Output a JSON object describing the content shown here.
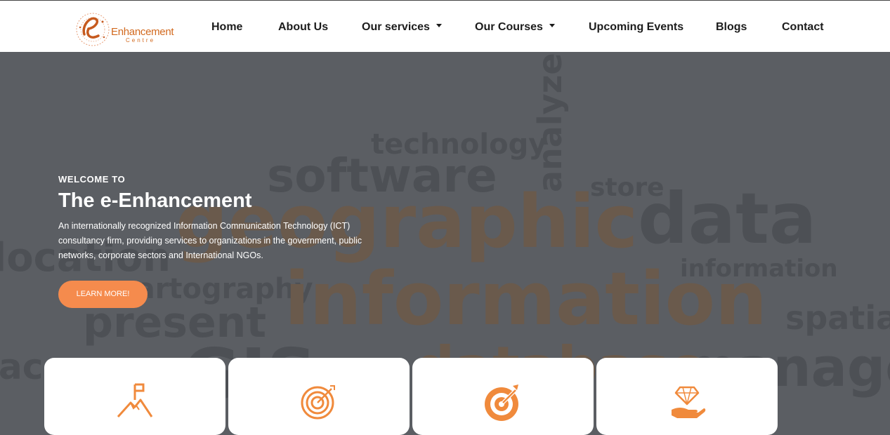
{
  "header": {
    "logo": {
      "text": "Enhancement",
      "subtext": "Centre",
      "icon": "e-letter-logo-icon"
    },
    "nav": [
      {
        "label": "Home"
      },
      {
        "label": "About Us"
      },
      {
        "label": "Our services",
        "dropdown": true
      },
      {
        "label": "Our Courses",
        "dropdown": true
      },
      {
        "label": "Upcoming Events"
      },
      {
        "label": "Blogs"
      },
      {
        "label": "Contact"
      }
    ]
  },
  "hero": {
    "eyebrow": "WELCOME TO",
    "title": "The e-Enhancement",
    "description": "An internationally recognized Information Communication Technology (ICT) consultancy firm, providing services to organizations in the government, public networks, corporate sectors and International NGOs.",
    "button_label": "LEARN MORE!",
    "background_words": [
      {
        "text": "analyze"
      },
      {
        "text": "technology"
      },
      {
        "text": "software"
      },
      {
        "text": "store"
      },
      {
        "text": "geographic"
      },
      {
        "text": "data"
      },
      {
        "text": "location"
      },
      {
        "text": "information"
      },
      {
        "text": "cartography"
      },
      {
        "text": "information"
      },
      {
        "text": "present"
      },
      {
        "text": "spatial"
      },
      {
        "text": "manage"
      },
      {
        "text": "ac"
      },
      {
        "text": "GIS"
      },
      {
        "text": "database"
      }
    ]
  },
  "cards": [
    {
      "icon": "mountain-flag-icon"
    },
    {
      "icon": "target-icon"
    },
    {
      "icon": "bullseye-arrow-icon"
    },
    {
      "icon": "diamond-hand-icon"
    }
  ],
  "colors": {
    "accent": "#f58b4d",
    "logo": "#d2691e",
    "hero_overlay": "#5b5e63",
    "nav_text": "#1c1c1c"
  }
}
